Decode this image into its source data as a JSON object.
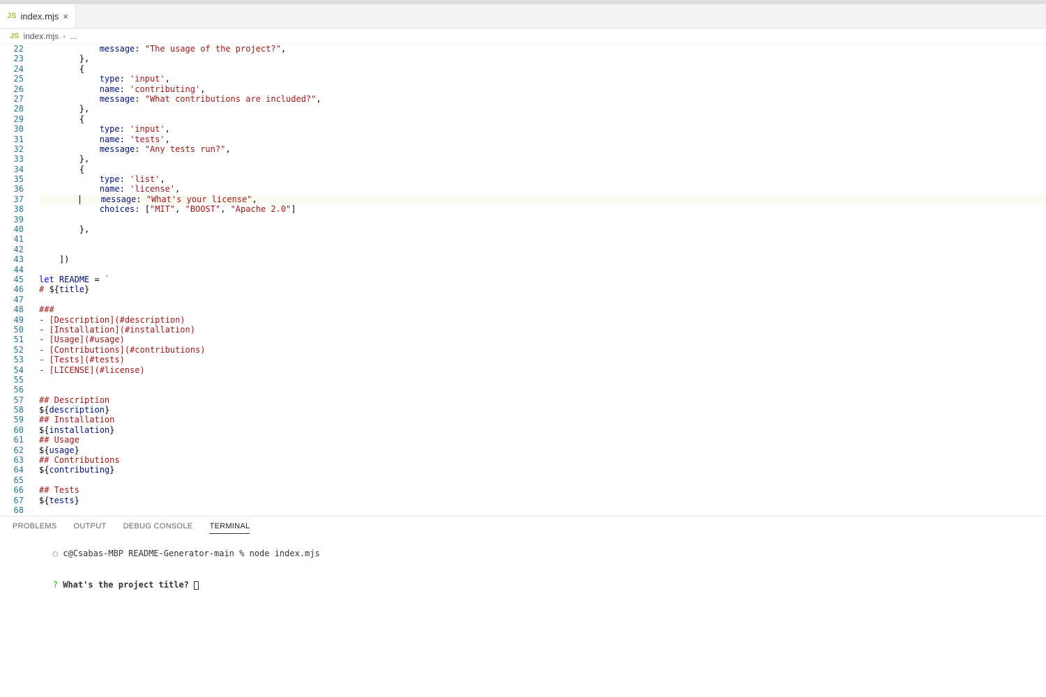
{
  "tab": {
    "icon": "JS",
    "title": "index.mjs"
  },
  "breadcrumb": {
    "icon": "JS",
    "file": "index.mjs",
    "sep": "›",
    "rest": "..."
  },
  "panel": {
    "tabs": [
      "PROBLEMS",
      "OUTPUT",
      "DEBUG CONSOLE",
      "TERMINAL"
    ],
    "active": 3
  },
  "terminal": {
    "line1_sym": "○",
    "line1_text": "c@Csabas-MBP README-Generator-main % node index.mjs",
    "line2_q": "?",
    "line2_text": "What's the project title?"
  },
  "code": {
    "start": 22,
    "lines": [
      [
        [
          "plain",
          "            "
        ],
        [
          "key",
          "message"
        ],
        [
          "punc",
          ": "
        ],
        [
          "str",
          "\"The usage of the project?\""
        ],
        [
          "punc",
          ","
        ]
      ],
      [
        [
          "plain",
          "        "
        ],
        [
          "punc",
          "},"
        ]
      ],
      [
        [
          "plain",
          "        "
        ],
        [
          "punc",
          "{"
        ]
      ],
      [
        [
          "plain",
          "            "
        ],
        [
          "key",
          "type"
        ],
        [
          "punc",
          ": "
        ],
        [
          "str",
          "'input'"
        ],
        [
          "punc",
          ","
        ]
      ],
      [
        [
          "plain",
          "            "
        ],
        [
          "key",
          "name"
        ],
        [
          "punc",
          ": "
        ],
        [
          "str",
          "'contributing'"
        ],
        [
          "punc",
          ","
        ]
      ],
      [
        [
          "plain",
          "            "
        ],
        [
          "key",
          "message"
        ],
        [
          "punc",
          ": "
        ],
        [
          "str",
          "\"What contributions are included?\""
        ],
        [
          "punc",
          ","
        ]
      ],
      [
        [
          "plain",
          "        "
        ],
        [
          "punc",
          "},"
        ]
      ],
      [
        [
          "plain",
          "        "
        ],
        [
          "punc",
          "{"
        ]
      ],
      [
        [
          "plain",
          "            "
        ],
        [
          "key",
          "type"
        ],
        [
          "punc",
          ": "
        ],
        [
          "str",
          "'input'"
        ],
        [
          "punc",
          ","
        ]
      ],
      [
        [
          "plain",
          "            "
        ],
        [
          "key",
          "name"
        ],
        [
          "punc",
          ": "
        ],
        [
          "str",
          "'tests'"
        ],
        [
          "punc",
          ","
        ]
      ],
      [
        [
          "plain",
          "            "
        ],
        [
          "key",
          "message"
        ],
        [
          "punc",
          ": "
        ],
        [
          "str",
          "\"Any tests run?\""
        ],
        [
          "punc",
          ","
        ]
      ],
      [
        [
          "plain",
          "        "
        ],
        [
          "punc",
          "},"
        ]
      ],
      [
        [
          "plain",
          "        "
        ],
        [
          "punc",
          "{"
        ]
      ],
      [
        [
          "plain",
          "            "
        ],
        [
          "key",
          "type"
        ],
        [
          "punc",
          ": "
        ],
        [
          "str",
          "'list'"
        ],
        [
          "punc",
          ","
        ]
      ],
      [
        [
          "plain",
          "            "
        ],
        [
          "key",
          "name"
        ],
        [
          "punc",
          ": "
        ],
        [
          "str",
          "'license'"
        ],
        [
          "punc",
          ","
        ]
      ],
      [
        [
          "plain",
          "            "
        ],
        [
          "key",
          "message"
        ],
        [
          "punc",
          ": "
        ],
        [
          "str",
          "\"What's your license\""
        ],
        [
          "punc",
          ","
        ]
      ],
      [
        [
          "plain",
          "            "
        ],
        [
          "key",
          "choices"
        ],
        [
          "punc",
          ": ["
        ],
        [
          "str",
          "\"MIT\""
        ],
        [
          "punc",
          ", "
        ],
        [
          "str",
          "\"BOOST\""
        ],
        [
          "punc",
          ", "
        ],
        [
          "str",
          "\"Apache 2.0\""
        ],
        [
          "punc",
          "]"
        ]
      ],
      [],
      [
        [
          "plain",
          "        "
        ],
        [
          "punc",
          "},"
        ]
      ],
      [],
      [],
      [
        [
          "plain",
          "    "
        ],
        [
          "punc",
          "])"
        ]
      ],
      [],
      [
        [
          "kw",
          "let"
        ],
        [
          "plain",
          " "
        ],
        [
          "var",
          "README"
        ],
        [
          "plain",
          " "
        ],
        [
          "punc",
          "="
        ],
        [
          "plain",
          " "
        ],
        [
          "str",
          "`"
        ]
      ],
      [
        [
          "tmpl",
          "# "
        ],
        [
          "punc",
          "${"
        ],
        [
          "var",
          "title"
        ],
        [
          "punc",
          "}"
        ]
      ],
      [],
      [
        [
          "tmpl",
          "###"
        ]
      ],
      [
        [
          "tmpl",
          "- [Description](#description)"
        ]
      ],
      [
        [
          "tmpl",
          "- [Installation](#installation)"
        ]
      ],
      [
        [
          "tmpl",
          "- [Usage](#usage)"
        ]
      ],
      [
        [
          "tmpl",
          "- [Contributions](#contributions)"
        ]
      ],
      [
        [
          "tmpl",
          "- [Tests](#tests)"
        ]
      ],
      [
        [
          "tmpl",
          "- [LICENSE](#license)"
        ]
      ],
      [],
      [],
      [
        [
          "tmpl",
          "## Description"
        ]
      ],
      [
        [
          "punc",
          "${"
        ],
        [
          "var",
          "description"
        ],
        [
          "punc",
          "}"
        ]
      ],
      [
        [
          "tmpl",
          "## Installation"
        ]
      ],
      [
        [
          "punc",
          "${"
        ],
        [
          "var",
          "installation"
        ],
        [
          "punc",
          "}"
        ]
      ],
      [
        [
          "tmpl",
          "## Usage"
        ]
      ],
      [
        [
          "punc",
          "${"
        ],
        [
          "var",
          "usage"
        ],
        [
          "punc",
          "}"
        ]
      ],
      [
        [
          "tmpl",
          "## Contributions"
        ]
      ],
      [
        [
          "punc",
          "${"
        ],
        [
          "var",
          "contributing"
        ],
        [
          "punc",
          "}"
        ]
      ],
      [],
      [
        [
          "tmpl",
          "## Tests"
        ]
      ],
      [
        [
          "punc",
          "${"
        ],
        [
          "var",
          "tests"
        ],
        [
          "punc",
          "}"
        ]
      ],
      [],
      []
    ],
    "activeLine": 37
  }
}
